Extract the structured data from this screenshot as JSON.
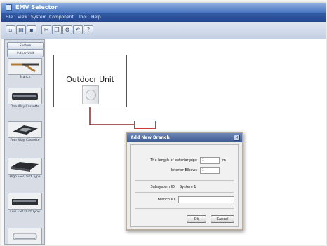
{
  "window": {
    "title": "EMV Selector"
  },
  "menu": [
    "File",
    "View",
    "System",
    "Component",
    "Tool",
    "Help"
  ],
  "sidebar": {
    "headers": [
      "System",
      "Indoor Unit"
    ],
    "items": [
      {
        "label": "Branch",
        "icon": "branch-pipe-icon"
      },
      {
        "label": "One Way Cassette",
        "icon": "one-way-cassette-icon"
      },
      {
        "label": "Four Way Cassette",
        "icon": "four-way-cassette-icon"
      },
      {
        "label": "High ESP Duct Type",
        "icon": "high-esp-duct-icon"
      },
      {
        "label": "Low ESP Duct Type",
        "icon": "low-esp-duct-icon"
      },
      {
        "label": "",
        "icon": "wall-mounted-icon"
      }
    ]
  },
  "canvas": {
    "outdoor_unit_label": "Outdoor Unit"
  },
  "dialog": {
    "title": "Add New Branch",
    "length_label": "The length of exterior pipe",
    "length_value": "1",
    "length_unit": "m",
    "elbows_label": "Interior Elbows",
    "elbows_value": "1",
    "subsystem_label": "Subsystem ID",
    "subsystem_value": "System 1",
    "branch_label": "Branch ID",
    "branch_value": "",
    "ok_label": "Ok",
    "cancel_label": "Cancel"
  },
  "colors": {
    "titlebar": "#4a76c0",
    "menubar": "#2a4f93",
    "connection_line": "#8b2a2a",
    "branch_highlight": "#cf3a3a"
  }
}
